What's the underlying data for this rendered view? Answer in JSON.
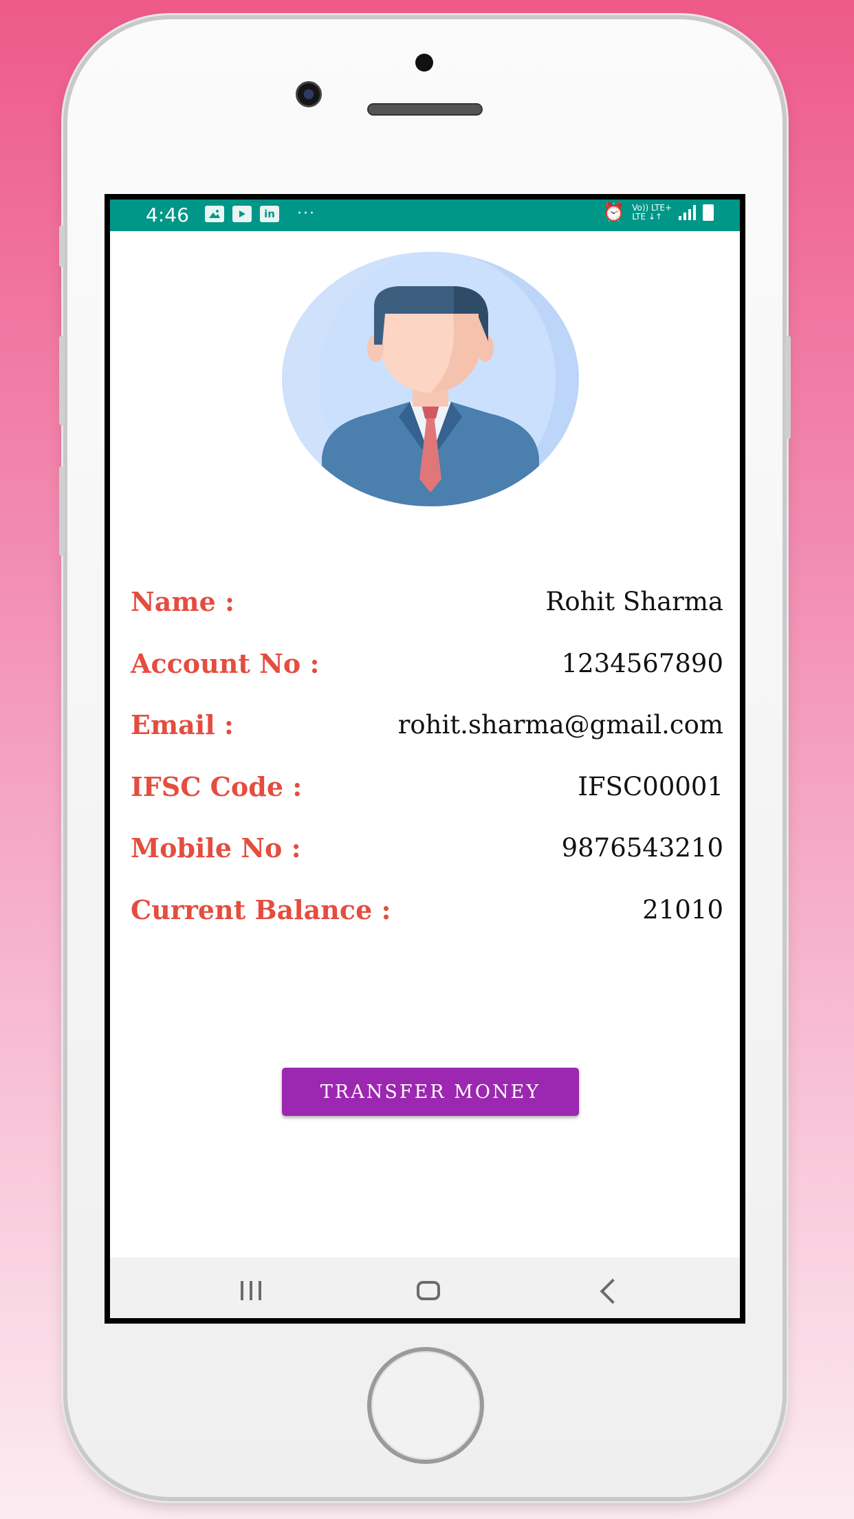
{
  "status_bar": {
    "time": "4:46",
    "left_icons": [
      "gallery-icon",
      "youtube-icon",
      "linkedin-icon"
    ],
    "more_indicator": "···",
    "network_label_top": "Vo)) LTE+",
    "network_label_bottom": "LTE ↓↑"
  },
  "profile": {
    "avatar": "businessman-avatar-icon",
    "fields": [
      {
        "label": "Name :",
        "value": "Rohit Sharma"
      },
      {
        "label": "Account No :",
        "value": "1234567890"
      },
      {
        "label": "Email :",
        "value": "rohit.sharma@gmail.com"
      },
      {
        "label": "IFSC Code :",
        "value": "IFSC00001"
      },
      {
        "label": "Mobile No :",
        "value": "9876543210"
      },
      {
        "label": "Current Balance :",
        "value": "21010"
      }
    ]
  },
  "actions": {
    "transfer_label": "TRANSFER MONEY"
  },
  "colors": {
    "status_bar": "#009688",
    "label": "#e44d3f",
    "button": "#9c27b0",
    "background_top": "#ee5a8a",
    "background_bottom": "#fcecf2"
  }
}
